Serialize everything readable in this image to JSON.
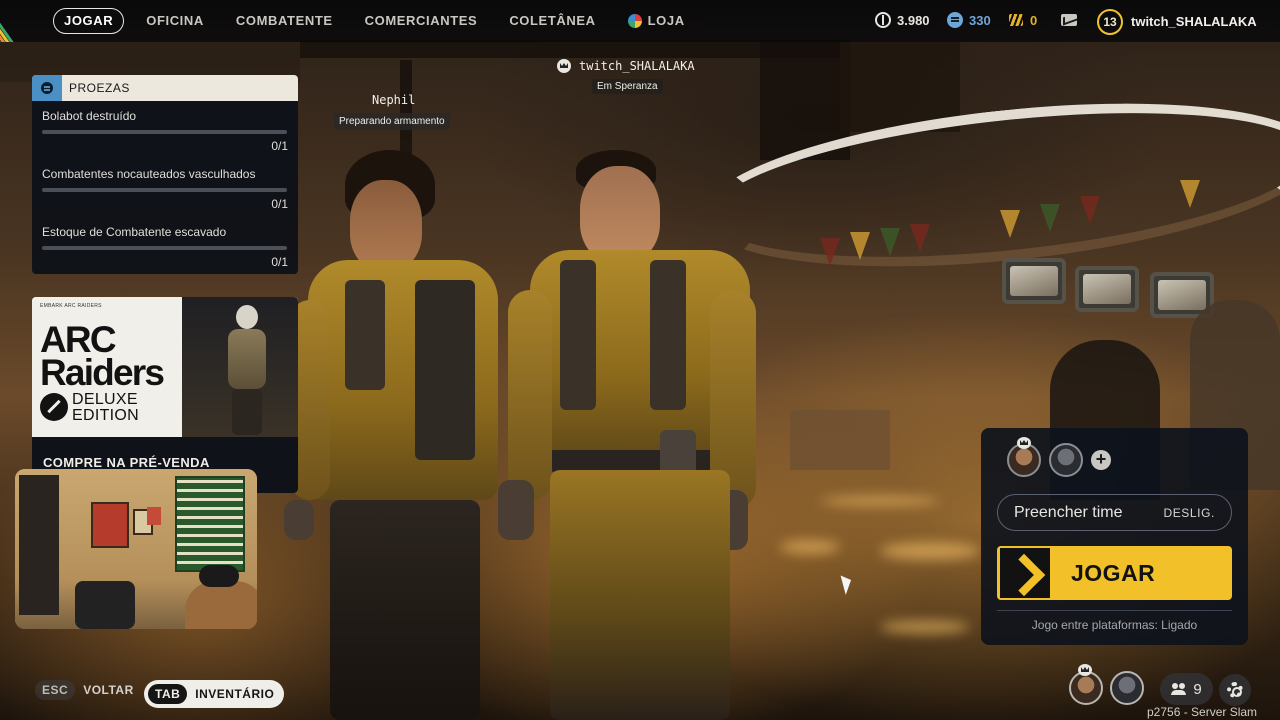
{
  "nav": {
    "tabs": [
      {
        "label": "JOGAR",
        "active": true
      },
      {
        "label": "OFICINA"
      },
      {
        "label": "COMBATENTE"
      },
      {
        "label": "COMERCIANTES"
      },
      {
        "label": "COLETÂNEA"
      },
      {
        "label": "LOJA",
        "icon": "store-icon"
      }
    ],
    "currencies": [
      {
        "icon": "coin-icon",
        "value": "3.980"
      },
      {
        "icon": "credits-icon",
        "value": "330",
        "color": "#6fa6d8"
      },
      {
        "icon": "raider-token-icon",
        "value": "0",
        "color": "#e3b22a"
      }
    ],
    "mail_icon": "mail-icon",
    "level": "13",
    "username": "twitch_SHALALAKA"
  },
  "proezas": {
    "title": "PROEZAS",
    "icon": "feats-icon",
    "tasks": [
      {
        "name": "Bolabot destruído",
        "count": "0/1",
        "progress": 0
      },
      {
        "name": "Combatentes nocauteados vasculhados",
        "count": "0/1",
        "progress": 0
      },
      {
        "name": "Estoque de Combatente escavado",
        "count": "0/1",
        "progress": 0
      }
    ]
  },
  "promo": {
    "logos": "EMBARK   ARC RAIDERS",
    "title_line1": "ARC",
    "title_line2": "Raiders",
    "edition_line1": "DELUXE",
    "edition_line2": "EDITION",
    "cta": "COMPRE NA PRÉ-VENDA"
  },
  "world": {
    "player_tag": "twitch_SHALALAKA",
    "player_status": "Em Speranza",
    "teammate_tag": "Nephil",
    "teammate_status": "Preparando armamento"
  },
  "squad": {
    "fill_label": "Preencher time",
    "fill_state": "DESLIG.",
    "play_label": "JOGAR",
    "crossplay": "Jogo entre plataformas: Ligado",
    "add_label": "+"
  },
  "bottom": {
    "back_key": "ESC",
    "back_label": "VOLTAR",
    "inventory_key": "TAB",
    "inventory_label": "INVENTÁRIO",
    "friends_count": "9",
    "server": "p2756 - Server Slam"
  },
  "colors": {
    "accent": "#f2c12a",
    "panel": "#0c1218",
    "feats_blue": "#4a90c4"
  }
}
